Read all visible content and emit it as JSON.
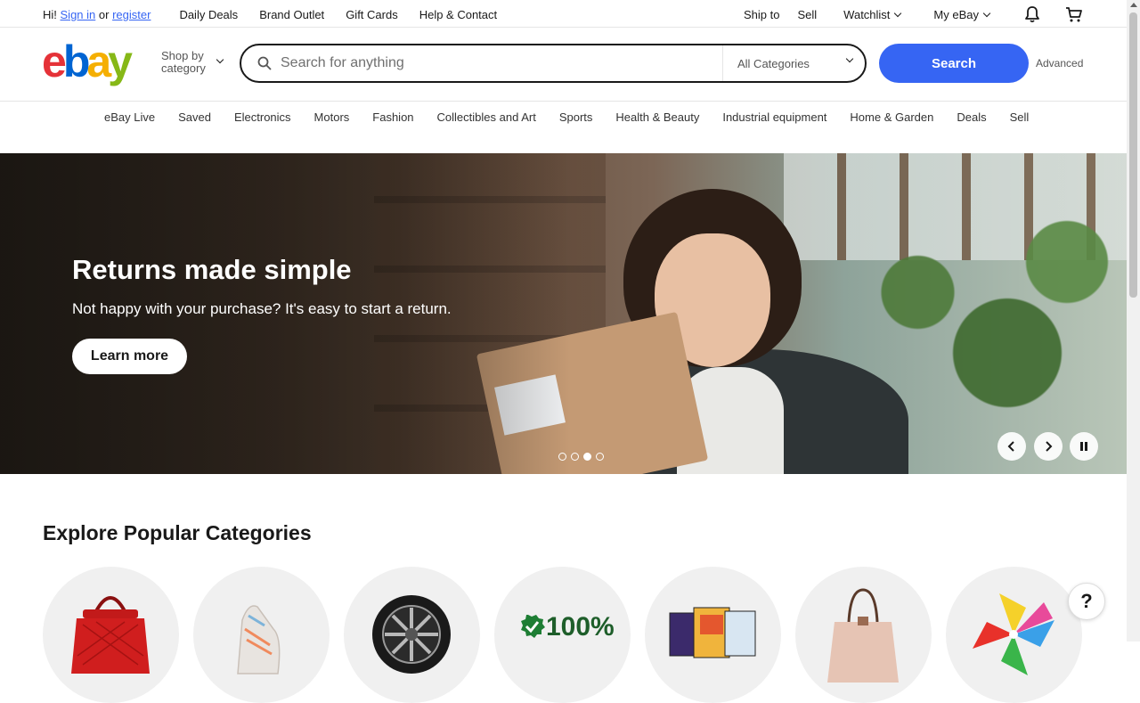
{
  "topbar": {
    "greeting": "Hi!",
    "sign_in": "Sign in",
    "or": "or",
    "register": "register",
    "links": [
      "Daily Deals",
      "Brand Outlet",
      "Gift Cards",
      "Help & Contact"
    ],
    "ship_to": "Ship to",
    "sell": "Sell",
    "watchlist": "Watchlist",
    "my_ebay": "My eBay"
  },
  "header": {
    "logo": {
      "e": "e",
      "b": "b",
      "a": "a",
      "y": "y"
    },
    "shop_by_line1": "Shop by",
    "shop_by_line2": "category",
    "search_placeholder": "Search for anything",
    "category_select": "All Categories",
    "search_button": "Search",
    "advanced": "Advanced"
  },
  "category_nav": [
    "eBay Live",
    "Saved",
    "Electronics",
    "Motors",
    "Fashion",
    "Collectibles and Art",
    "Sports",
    "Health & Beauty",
    "Industrial equipment",
    "Home & Garden",
    "Deals",
    "Sell"
  ],
  "hero": {
    "title": "Returns made simple",
    "subtitle": "Not happy with your purchase? It's easy to start a return.",
    "cta": "Learn more",
    "slide_count": 4,
    "active_slide": 3
  },
  "explore": {
    "title": "Explore Popular Categories",
    "badge_text": "100%"
  },
  "help_button": "?",
  "colors": {
    "brand_blue": "#3665f3",
    "logo_red": "#e53238",
    "logo_blue": "#0064d2",
    "logo_yellow": "#f5af02",
    "logo_green": "#86b817",
    "badge_green": "#1e7e34"
  }
}
